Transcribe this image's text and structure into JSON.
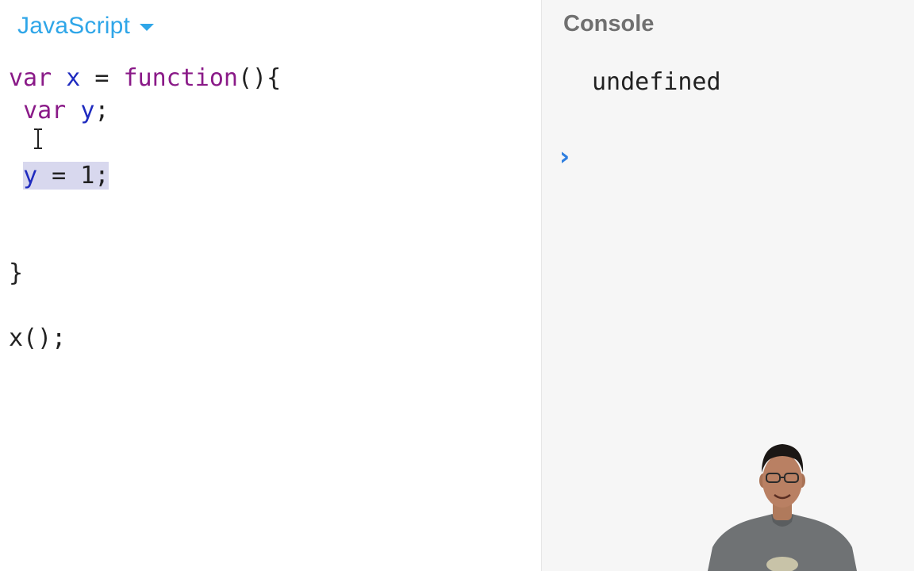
{
  "editor": {
    "language": "JavaScript",
    "code": {
      "line1": {
        "kw_var": "var",
        "name": "x",
        "op": " = ",
        "kw_function": "function",
        "tail": "(){"
      },
      "line2": {
        "indent": " ",
        "kw_var": "var",
        "name": "y",
        "tail": ";"
      },
      "line4": {
        "indent": " ",
        "name": "y",
        "rest": " = 1;"
      },
      "line7": "}",
      "line9": "x();"
    }
  },
  "console": {
    "title": "Console",
    "output": "undefined",
    "prompt_symbol": "›"
  },
  "colors": {
    "language_accent": "#2fa6e8",
    "keyword": "#8a1a88",
    "identifier": "#1f2bbf",
    "selection": "#d8d8ee",
    "prompt": "#2f7fe0"
  },
  "icons": [
    "caret-down-icon",
    "text-cursor-icon",
    "console-prompt-icon"
  ]
}
